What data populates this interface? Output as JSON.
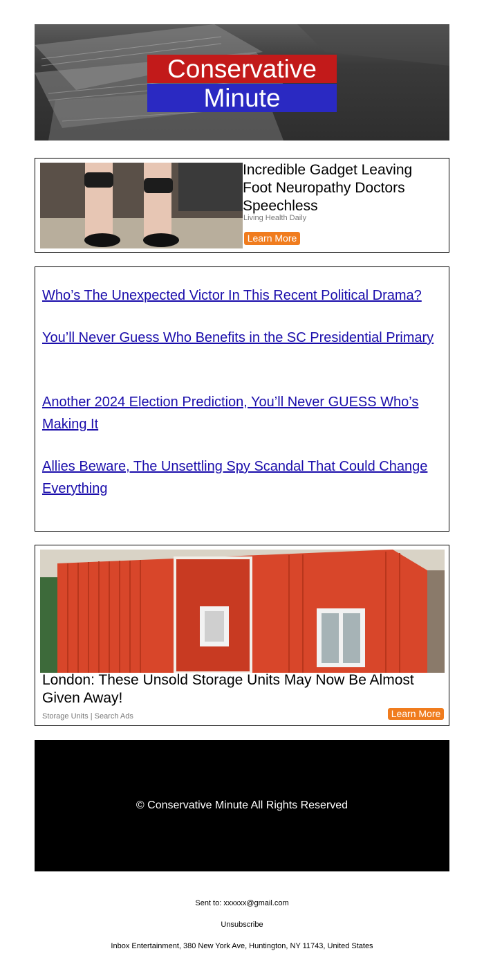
{
  "header": {
    "logo_line1": "Conservative",
    "logo_line2": "Minute",
    "logo_colors": {
      "top": "#c21a1a",
      "bottom": "#2a29c2"
    }
  },
  "ad1": {
    "title": "Incredible Gadget Leaving Foot Neuropathy Doctors Speechless",
    "source": "Living Health Daily",
    "button": "Learn More"
  },
  "links": [
    "Who’s The Unexpected Victor In This Recent Political Drama?",
    "You’ll Never Guess Who Benefits in the SC Presidential Primary",
    "Another 2024 Election Prediction, You’ll Never GUESS Who’s Making It",
    "Allies Beware, The Unsettling Spy Scandal That Could Change Everything"
  ],
  "ad2": {
    "title": "London: These Unsold Storage Units May Now Be Almost Given Away!",
    "source": "Storage Units | Search Ads",
    "button": "Learn More"
  },
  "footer": {
    "copyright": "© Conservative Minute All Rights Reserved",
    "sent_to": "Sent to: xxxxxx@gmail.com",
    "unsubscribe": "Unsubscribe",
    "address": "Inbox Entertainment, 380 New York Ave, Huntington, NY 11743, United States"
  },
  "accent_color": "#f07c1e",
  "link_color": "#1a0dab"
}
